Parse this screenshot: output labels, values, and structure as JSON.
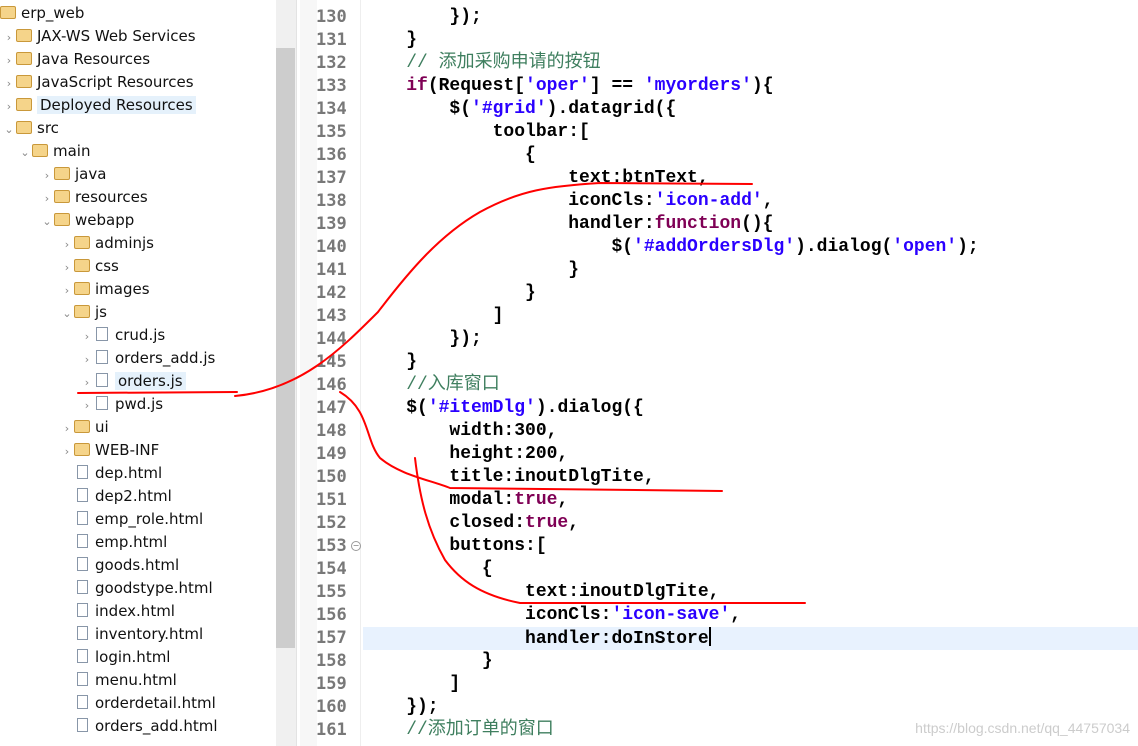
{
  "project_tree": {
    "items": [
      {
        "label": "erp_web",
        "level": 0,
        "chev": "",
        "icon": "project-icon"
      },
      {
        "label": "JAX-WS Web Services",
        "level": 1,
        "chev": ">",
        "icon": "webservices-icon"
      },
      {
        "label": "Java Resources",
        "level": 1,
        "chev": ">",
        "icon": "java-resources-icon"
      },
      {
        "label": "JavaScript Resources",
        "level": 1,
        "chev": ">",
        "icon": "javascript-resources-icon"
      },
      {
        "label": "Deployed Resources",
        "level": 1,
        "chev": ">",
        "icon": "deployed-resources-icon",
        "selected": true
      },
      {
        "label": "src",
        "level": 1,
        "chev": "v",
        "icon": "folder-icon"
      },
      {
        "label": "main",
        "level": 2,
        "chev": "v",
        "icon": "folder-icon"
      },
      {
        "label": "java",
        "level": 3,
        "chev": ">",
        "icon": "folder-icon"
      },
      {
        "label": "resources",
        "level": 3,
        "chev": ">",
        "icon": "folder-icon"
      },
      {
        "label": "webapp",
        "level": 3,
        "chev": "v",
        "icon": "folder-icon"
      },
      {
        "label": "adminjs",
        "level": 4,
        "chev": ">",
        "icon": "folder-icon"
      },
      {
        "label": "css",
        "level": 4,
        "chev": ">",
        "icon": "folder-icon"
      },
      {
        "label": "images",
        "level": 4,
        "chev": ">",
        "icon": "folder-icon"
      },
      {
        "label": "js",
        "level": 4,
        "chev": "v",
        "icon": "folder-icon"
      },
      {
        "label": "crud.js",
        "level": 5,
        "chev": ">",
        "icon": "js-file-icon"
      },
      {
        "label": "orders_add.js",
        "level": 5,
        "chev": ">",
        "icon": "js-file-icon"
      },
      {
        "label": "orders.js",
        "level": 5,
        "chev": ">",
        "icon": "js-file-icon",
        "selected": true
      },
      {
        "label": "pwd.js",
        "level": 5,
        "chev": ">",
        "icon": "js-file-icon"
      },
      {
        "label": "ui",
        "level": 4,
        "chev": ">",
        "icon": "folder-icon"
      },
      {
        "label": "WEB-INF",
        "level": 4,
        "chev": ">",
        "icon": "folder-icon"
      },
      {
        "label": "dep.html",
        "level": 4,
        "chev": "",
        "icon": "html-file-icon"
      },
      {
        "label": "dep2.html",
        "level": 4,
        "chev": "",
        "icon": "html-file-icon"
      },
      {
        "label": "emp_role.html",
        "level": 4,
        "chev": "",
        "icon": "html-file-icon"
      },
      {
        "label": "emp.html",
        "level": 4,
        "chev": "",
        "icon": "html-file-icon"
      },
      {
        "label": "goods.html",
        "level": 4,
        "chev": "",
        "icon": "html-file-icon"
      },
      {
        "label": "goodstype.html",
        "level": 4,
        "chev": "",
        "icon": "html-file-icon"
      },
      {
        "label": "index.html",
        "level": 4,
        "chev": "",
        "icon": "html-file-icon"
      },
      {
        "label": "inventory.html",
        "level": 4,
        "chev": "",
        "icon": "html-file-icon"
      },
      {
        "label": "login.html",
        "level": 4,
        "chev": "",
        "icon": "html-file-icon"
      },
      {
        "label": "menu.html",
        "level": 4,
        "chev": "",
        "icon": "html-file-icon"
      },
      {
        "label": "orderdetail.html",
        "level": 4,
        "chev": "",
        "icon": "html-file-icon"
      },
      {
        "label": "orders_add.html",
        "level": 4,
        "chev": "",
        "icon": "html-file-icon"
      }
    ]
  },
  "editor": {
    "current_line": 157,
    "colors": {
      "keyword": "#7f0055",
      "string": "#2a00ff",
      "comment": "#3f7f5f",
      "current_line_bg": "#e8f2fe"
    },
    "lines": [
      {
        "n": "130",
        "tokens": [
          [
            "        });",
            ""
          ]
        ]
      },
      {
        "n": "131",
        "tokens": [
          [
            "    }",
            ""
          ]
        ]
      },
      {
        "n": "132",
        "tokens": [
          [
            "    // 添加采购申请的按钮",
            "cm"
          ]
        ]
      },
      {
        "n": "133",
        "tokens": [
          [
            "    ",
            ""
          ],
          [
            "if",
            "kw"
          ],
          [
            "(Request[",
            ""
          ],
          [
            "'oper'",
            "str"
          ],
          [
            "] == ",
            ""
          ],
          [
            "'myorders'",
            "str"
          ],
          [
            "){",
            ""
          ]
        ]
      },
      {
        "n": "134",
        "tokens": [
          [
            "        $(",
            ""
          ],
          [
            "'#grid'",
            "str"
          ],
          [
            ").datagrid({",
            ""
          ]
        ]
      },
      {
        "n": "135",
        "tokens": [
          [
            "            toolbar:[",
            ""
          ]
        ]
      },
      {
        "n": "136",
        "tokens": [
          [
            "               {",
            ""
          ]
        ]
      },
      {
        "n": "137",
        "tokens": [
          [
            "                   text:btnText,",
            ""
          ]
        ]
      },
      {
        "n": "138",
        "tokens": [
          [
            "                   iconCls:",
            ""
          ],
          [
            "'icon-add'",
            "str"
          ],
          [
            ",",
            ""
          ]
        ]
      },
      {
        "n": "139",
        "tokens": [
          [
            "                   handler:",
            ""
          ],
          [
            "function",
            "kw"
          ],
          [
            "(){",
            ""
          ]
        ]
      },
      {
        "n": "140",
        "tokens": [
          [
            "                       $(",
            ""
          ],
          [
            "'#addOrdersDlg'",
            "str"
          ],
          [
            ").dialog(",
            ""
          ],
          [
            "'open'",
            "str"
          ],
          [
            ");",
            ""
          ]
        ]
      },
      {
        "n": "141",
        "tokens": [
          [
            "                   }",
            ""
          ]
        ]
      },
      {
        "n": "142",
        "tokens": [
          [
            "               }",
            ""
          ]
        ]
      },
      {
        "n": "143",
        "tokens": [
          [
            "            ]",
            ""
          ]
        ]
      },
      {
        "n": "144",
        "tokens": [
          [
            "        });",
            ""
          ]
        ]
      },
      {
        "n": "145",
        "tokens": [
          [
            "    }",
            ""
          ]
        ]
      },
      {
        "n": "146",
        "tokens": [
          [
            "    //入库窗口",
            "cm"
          ]
        ]
      },
      {
        "n": "147",
        "tokens": [
          [
            "    $(",
            ""
          ],
          [
            "'#itemDlg'",
            "str"
          ],
          [
            ").dialog({",
            ""
          ]
        ]
      },
      {
        "n": "148",
        "tokens": [
          [
            "        width:300,",
            ""
          ]
        ]
      },
      {
        "n": "149",
        "tokens": [
          [
            "        height:200,",
            ""
          ]
        ]
      },
      {
        "n": "150",
        "tokens": [
          [
            "        title:inoutDlgTite,",
            ""
          ]
        ]
      },
      {
        "n": "151",
        "tokens": [
          [
            "        modal:",
            ""
          ],
          [
            "true",
            "kw"
          ],
          [
            ",",
            ""
          ]
        ]
      },
      {
        "n": "152",
        "tokens": [
          [
            "        closed:",
            ""
          ],
          [
            "true",
            "kw"
          ],
          [
            ",",
            ""
          ]
        ]
      },
      {
        "n": "153",
        "tokens": [
          [
            "        buttons:[",
            ""
          ]
        ]
      },
      {
        "n": "154",
        "tokens": [
          [
            "           {",
            ""
          ]
        ]
      },
      {
        "n": "155",
        "tokens": [
          [
            "               text:inoutDlgTite,",
            ""
          ]
        ]
      },
      {
        "n": "156",
        "tokens": [
          [
            "               iconCls:",
            ""
          ],
          [
            "'icon-save'",
            "str"
          ],
          [
            ",",
            ""
          ]
        ]
      },
      {
        "n": "157",
        "tokens": [
          [
            "               handler:doInStore",
            ""
          ]
        ]
      },
      {
        "n": "158",
        "tokens": [
          [
            "           }",
            ""
          ]
        ]
      },
      {
        "n": "159",
        "tokens": [
          [
            "        ]",
            ""
          ]
        ]
      },
      {
        "n": "160",
        "tokens": [
          [
            "    });",
            ""
          ]
        ]
      },
      {
        "n": "161",
        "tokens": [
          [
            "    //添加订单的窗口",
            "cm"
          ]
        ]
      }
    ]
  },
  "watermark": "https://blog.csdn.net/qq_44757034"
}
